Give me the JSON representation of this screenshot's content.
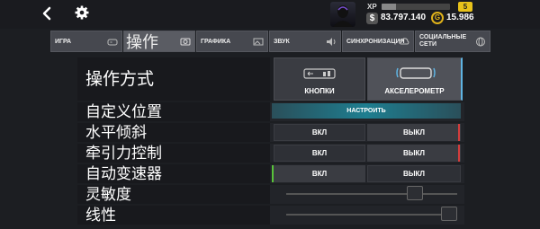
{
  "header": {
    "xp_label": "XP",
    "xp_progress": 0.21,
    "level": "5",
    "money_symbol": "$",
    "money": "83.797.140",
    "gold_symbol": "G",
    "gold": "15.986"
  },
  "tabs": [
    {
      "label": "ИГРА",
      "icon": "gamepad-icon"
    },
    {
      "label": "操作",
      "icon": "steering-wheel-icon",
      "active": true
    },
    {
      "label": "ГРАФИКА",
      "icon": "image-icon"
    },
    {
      "label": "ЗВУК",
      "icon": "speaker-icon"
    },
    {
      "label": "СИНХРОНИЗАЦИЯ",
      "icon": "cloud-icon"
    },
    {
      "label": "СОЦИАЛЬНЫЕ СЕТИ",
      "icon": "globe-icon"
    }
  ],
  "control_method": {
    "label": "操作方式",
    "options": [
      {
        "label": "КНОПКИ",
        "icon": "buttons-icon",
        "selected": false
      },
      {
        "label": "АКСЕЛЕРОМЕТР",
        "icon": "phone-tilt-icon",
        "selected": true
      }
    ]
  },
  "rows": {
    "custom_position": {
      "label": "自定义位置",
      "button": "НАСТРОИТЬ"
    },
    "horizontal_tilt": {
      "label": "水平倾斜",
      "on": "ВКЛ",
      "off": "ВЫКЛ",
      "value": "off"
    },
    "traction_control": {
      "label": "牵引力控制",
      "on": "ВКЛ",
      "off": "ВЫКЛ",
      "value": "off"
    },
    "auto_transmission": {
      "label": "自动变速器",
      "on": "ВКЛ",
      "off": "ВЫКЛ",
      "value": "on"
    },
    "sensitivity": {
      "label": "灵敏度",
      "value": 0.78
    },
    "linearity": {
      "label": "线性",
      "value": 1.0
    }
  },
  "colors": {
    "accent_blue": "#5fb4e3",
    "off_red": "#d43d3d",
    "on_green": "#58c23a",
    "level_badge": "#e8c21a"
  }
}
